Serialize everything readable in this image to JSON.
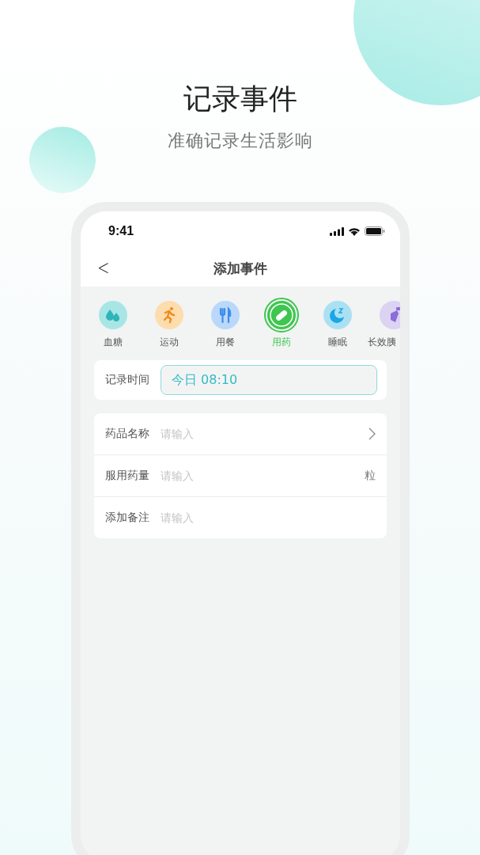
{
  "heading": {
    "title": "记录事件",
    "subtitle": "准确记录生活影响"
  },
  "status_bar": {
    "time": "9:41"
  },
  "nav": {
    "title": "添加事件",
    "back": "<"
  },
  "categories": [
    {
      "kind": "glucose",
      "label": "血糖",
      "color": "#a8e6e6",
      "selected": false
    },
    {
      "kind": "exercise",
      "label": "运动",
      "color": "#fddcae",
      "selected": false
    },
    {
      "kind": "meal",
      "label": "用餐",
      "color": "#b9d8fb",
      "selected": false
    },
    {
      "kind": "medication",
      "label": "用药",
      "color": "#3ec64f",
      "selected": true
    },
    {
      "kind": "sleep",
      "label": "睡眠",
      "color": "#abe0f3",
      "selected": false
    },
    {
      "kind": "insulin",
      "label": "长效胰",
      "color": "#dcd3f3",
      "selected": false
    }
  ],
  "record_time": {
    "label": "记录时间",
    "value": "今日 08:10"
  },
  "form": [
    {
      "kind": "chevron",
      "label": "药品名称",
      "placeholder": "请输入"
    },
    {
      "kind": "unit",
      "label": "服用药量",
      "placeholder": "请输入",
      "unit": "粒"
    },
    {
      "kind": "plain",
      "label": "添加备注",
      "placeholder": "请输入"
    }
  ]
}
